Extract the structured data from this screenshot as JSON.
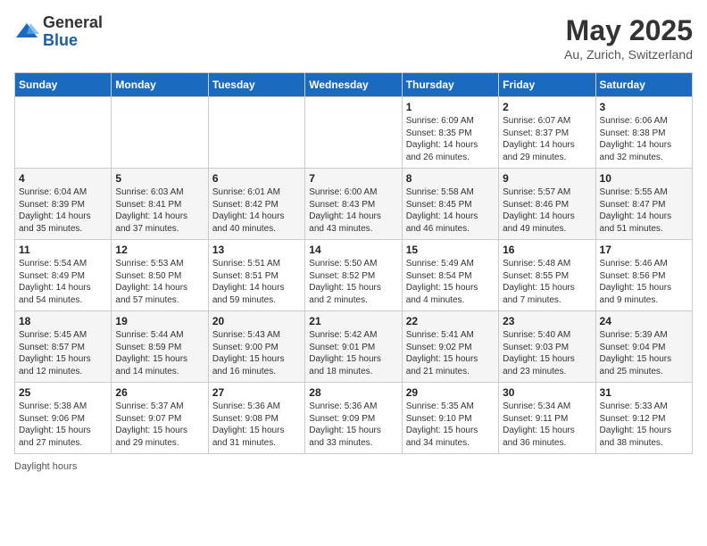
{
  "logo": {
    "general": "General",
    "blue": "Blue"
  },
  "title": "May 2025",
  "location": "Au, Zurich, Switzerland",
  "headers": [
    "Sunday",
    "Monday",
    "Tuesday",
    "Wednesday",
    "Thursday",
    "Friday",
    "Saturday"
  ],
  "footer": "Daylight hours",
  "weeks": [
    [
      {
        "day": "",
        "info": ""
      },
      {
        "day": "",
        "info": ""
      },
      {
        "day": "",
        "info": ""
      },
      {
        "day": "",
        "info": ""
      },
      {
        "day": "1",
        "info": "Sunrise: 6:09 AM\nSunset: 8:35 PM\nDaylight: 14 hours and 26 minutes."
      },
      {
        "day": "2",
        "info": "Sunrise: 6:07 AM\nSunset: 8:37 PM\nDaylight: 14 hours and 29 minutes."
      },
      {
        "day": "3",
        "info": "Sunrise: 6:06 AM\nSunset: 8:38 PM\nDaylight: 14 hours and 32 minutes."
      }
    ],
    [
      {
        "day": "4",
        "info": "Sunrise: 6:04 AM\nSunset: 8:39 PM\nDaylight: 14 hours and 35 minutes."
      },
      {
        "day": "5",
        "info": "Sunrise: 6:03 AM\nSunset: 8:41 PM\nDaylight: 14 hours and 37 minutes."
      },
      {
        "day": "6",
        "info": "Sunrise: 6:01 AM\nSunset: 8:42 PM\nDaylight: 14 hours and 40 minutes."
      },
      {
        "day": "7",
        "info": "Sunrise: 6:00 AM\nSunset: 8:43 PM\nDaylight: 14 hours and 43 minutes."
      },
      {
        "day": "8",
        "info": "Sunrise: 5:58 AM\nSunset: 8:45 PM\nDaylight: 14 hours and 46 minutes."
      },
      {
        "day": "9",
        "info": "Sunrise: 5:57 AM\nSunset: 8:46 PM\nDaylight: 14 hours and 49 minutes."
      },
      {
        "day": "10",
        "info": "Sunrise: 5:55 AM\nSunset: 8:47 PM\nDaylight: 14 hours and 51 minutes."
      }
    ],
    [
      {
        "day": "11",
        "info": "Sunrise: 5:54 AM\nSunset: 8:49 PM\nDaylight: 14 hours and 54 minutes."
      },
      {
        "day": "12",
        "info": "Sunrise: 5:53 AM\nSunset: 8:50 PM\nDaylight: 14 hours and 57 minutes."
      },
      {
        "day": "13",
        "info": "Sunrise: 5:51 AM\nSunset: 8:51 PM\nDaylight: 14 hours and 59 minutes."
      },
      {
        "day": "14",
        "info": "Sunrise: 5:50 AM\nSunset: 8:52 PM\nDaylight: 15 hours and 2 minutes."
      },
      {
        "day": "15",
        "info": "Sunrise: 5:49 AM\nSunset: 8:54 PM\nDaylight: 15 hours and 4 minutes."
      },
      {
        "day": "16",
        "info": "Sunrise: 5:48 AM\nSunset: 8:55 PM\nDaylight: 15 hours and 7 minutes."
      },
      {
        "day": "17",
        "info": "Sunrise: 5:46 AM\nSunset: 8:56 PM\nDaylight: 15 hours and 9 minutes."
      }
    ],
    [
      {
        "day": "18",
        "info": "Sunrise: 5:45 AM\nSunset: 8:57 PM\nDaylight: 15 hours and 12 minutes."
      },
      {
        "day": "19",
        "info": "Sunrise: 5:44 AM\nSunset: 8:59 PM\nDaylight: 15 hours and 14 minutes."
      },
      {
        "day": "20",
        "info": "Sunrise: 5:43 AM\nSunset: 9:00 PM\nDaylight: 15 hours and 16 minutes."
      },
      {
        "day": "21",
        "info": "Sunrise: 5:42 AM\nSunset: 9:01 PM\nDaylight: 15 hours and 18 minutes."
      },
      {
        "day": "22",
        "info": "Sunrise: 5:41 AM\nSunset: 9:02 PM\nDaylight: 15 hours and 21 minutes."
      },
      {
        "day": "23",
        "info": "Sunrise: 5:40 AM\nSunset: 9:03 PM\nDaylight: 15 hours and 23 minutes."
      },
      {
        "day": "24",
        "info": "Sunrise: 5:39 AM\nSunset: 9:04 PM\nDaylight: 15 hours and 25 minutes."
      }
    ],
    [
      {
        "day": "25",
        "info": "Sunrise: 5:38 AM\nSunset: 9:06 PM\nDaylight: 15 hours and 27 minutes."
      },
      {
        "day": "26",
        "info": "Sunrise: 5:37 AM\nSunset: 9:07 PM\nDaylight: 15 hours and 29 minutes."
      },
      {
        "day": "27",
        "info": "Sunrise: 5:36 AM\nSunset: 9:08 PM\nDaylight: 15 hours and 31 minutes."
      },
      {
        "day": "28",
        "info": "Sunrise: 5:36 AM\nSunset: 9:09 PM\nDaylight: 15 hours and 33 minutes."
      },
      {
        "day": "29",
        "info": "Sunrise: 5:35 AM\nSunset: 9:10 PM\nDaylight: 15 hours and 34 minutes."
      },
      {
        "day": "30",
        "info": "Sunrise: 5:34 AM\nSunset: 9:11 PM\nDaylight: 15 hours and 36 minutes."
      },
      {
        "day": "31",
        "info": "Sunrise: 5:33 AM\nSunset: 9:12 PM\nDaylight: 15 hours and 38 minutes."
      }
    ]
  ]
}
